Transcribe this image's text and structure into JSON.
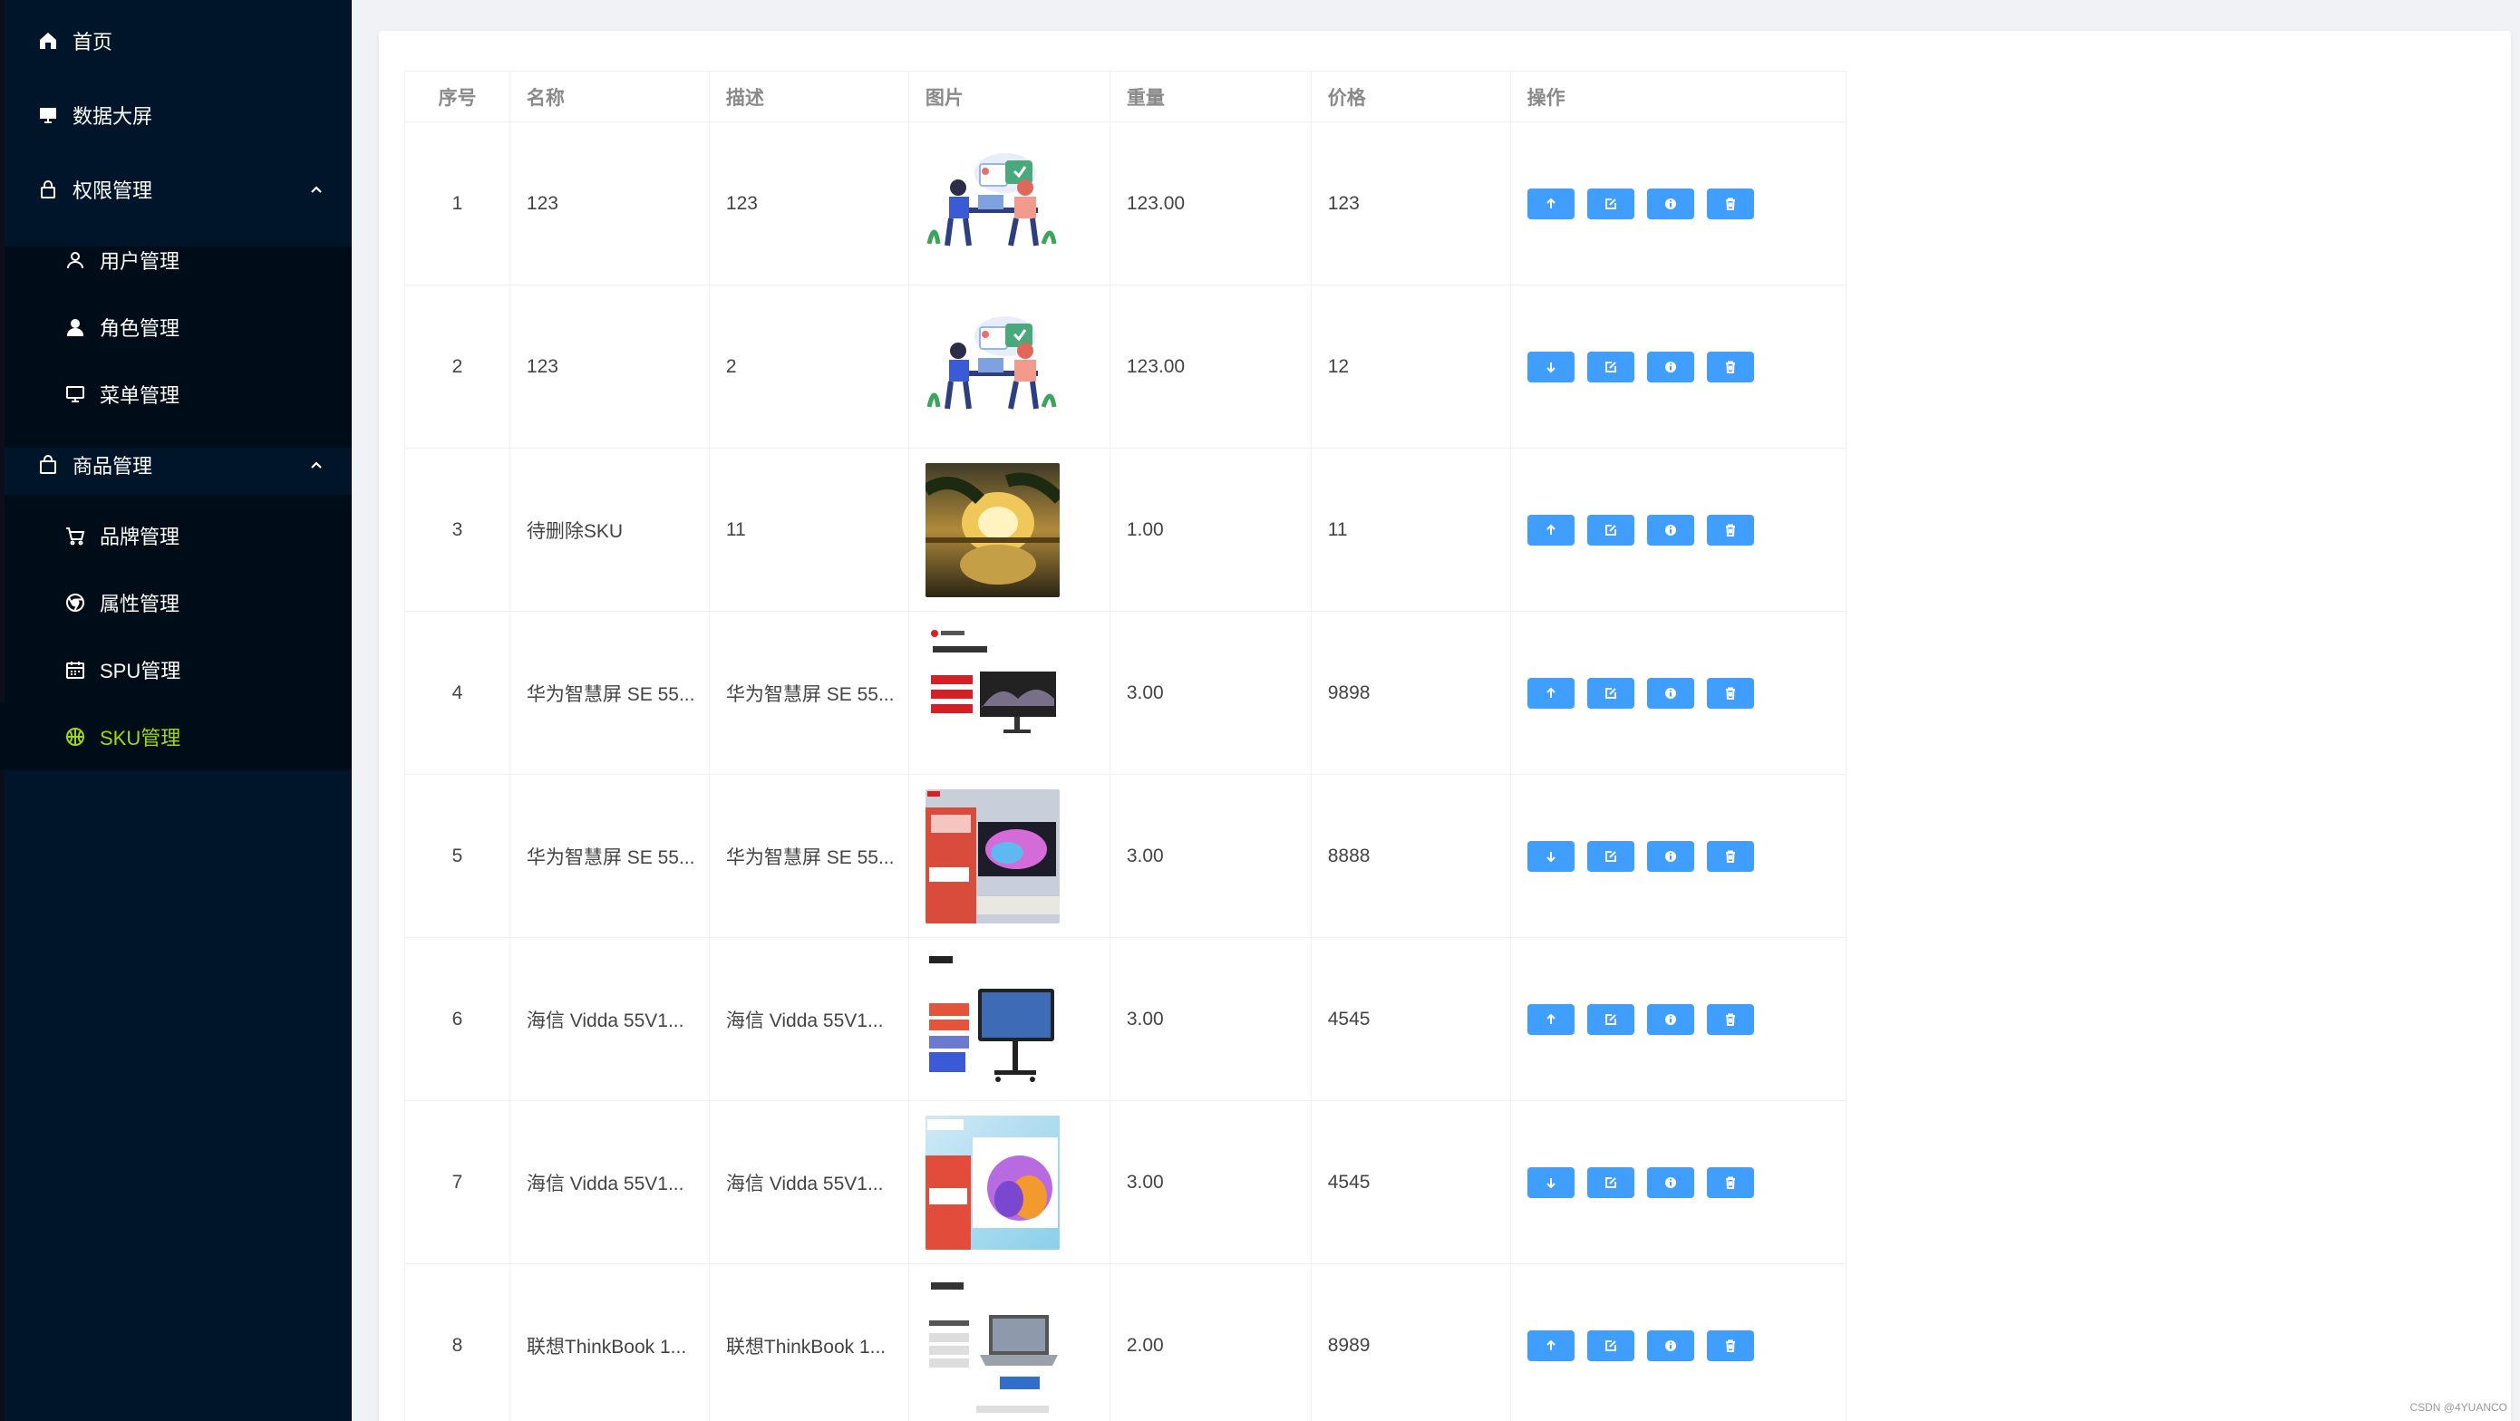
{
  "sidebar": {
    "items": [
      {
        "label": "首页",
        "icon": "home-icon"
      },
      {
        "label": "数据大屏",
        "icon": "monitor-icon"
      },
      {
        "label": "权限管理",
        "icon": "lock-icon",
        "expanded": true
      },
      {
        "label": "用户管理",
        "icon": "user-icon"
      },
      {
        "label": "角色管理",
        "icon": "user-filled-icon"
      },
      {
        "label": "菜单管理",
        "icon": "monitor-icon"
      },
      {
        "label": "商品管理",
        "icon": "shopping-bag-icon",
        "expanded": true
      },
      {
        "label": "品牌管理",
        "icon": "shopping-cart-icon"
      },
      {
        "label": "属性管理",
        "icon": "chrome-icon"
      },
      {
        "label": "SPU管理",
        "icon": "calendar-icon"
      },
      {
        "label": "SKU管理",
        "icon": "basketball-icon",
        "active": true
      }
    ],
    "bg_color": "#001529",
    "active_color": "#a0d911"
  },
  "table": {
    "headers": [
      "序号",
      "名称",
      "描述",
      "图片",
      "重量",
      "价格",
      "操作"
    ],
    "rows": [
      {
        "index": "1",
        "name": "123",
        "desc": "123",
        "image": "illustration-people",
        "weight": "123.00",
        "price": "123",
        "sale_icon": "arrow-up-icon"
      },
      {
        "index": "2",
        "name": "123",
        "desc": "2",
        "image": "illustration-people",
        "weight": "123.00",
        "price": "12",
        "sale_icon": "arrow-down-icon"
      },
      {
        "index": "3",
        "name": "待删除SKU",
        "desc": "11",
        "image": "landscape-photo",
        "weight": "1.00",
        "price": "11",
        "sale_icon": "arrow-up-icon"
      },
      {
        "index": "4",
        "name": "华为智慧屏 SE 55...",
        "desc": "华为智慧屏 SE 55...",
        "image": "huawei-monitor",
        "weight": "3.00",
        "price": "9898",
        "sale_icon": "arrow-up-icon"
      },
      {
        "index": "5",
        "name": "华为智慧屏 SE 55...",
        "desc": "华为智慧屏 SE 55...",
        "image": "huawei-tv",
        "weight": "3.00",
        "price": "8888",
        "sale_icon": "arrow-down-icon"
      },
      {
        "index": "6",
        "name": "海信 Vidda 55V1...",
        "desc": "海信 Vidda 55V1...",
        "image": "hisense-board",
        "weight": "3.00",
        "price": "4545",
        "sale_icon": "arrow-up-icon"
      },
      {
        "index": "7",
        "name": "海信 Vidda 55V1...",
        "desc": "海信 Vidda 55V1...",
        "image": "vidda-tv",
        "weight": "3.00",
        "price": "4545",
        "sale_icon": "arrow-down-icon"
      },
      {
        "index": "8",
        "name": "联想ThinkBook 1...",
        "desc": "联想ThinkBook 1...",
        "image": "thinkbook-laptop",
        "weight": "2.00",
        "price": "8989",
        "sale_icon": "arrow-up-icon"
      }
    ],
    "button_color": "#409eff"
  },
  "watermark": "CSDN @4YUANCO"
}
